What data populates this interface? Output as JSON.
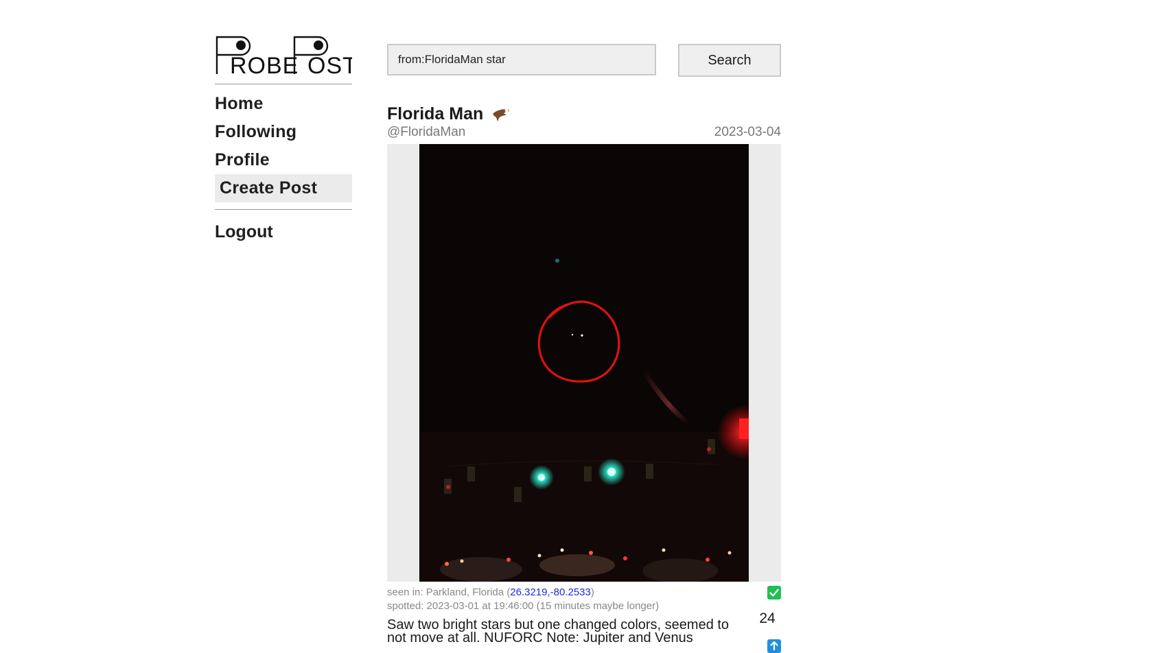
{
  "app": {
    "logo_text": "PROBEPOST"
  },
  "nav": {
    "items": [
      {
        "label": "Home",
        "active": false
      },
      {
        "label": "Following",
        "active": false
      },
      {
        "label": "Profile",
        "active": false
      },
      {
        "label": "Create Post",
        "active": true
      }
    ],
    "logout_label": "Logout"
  },
  "search": {
    "value": "from:FloridaMan star",
    "button_label": "Search"
  },
  "post": {
    "author_name": "Florida Man",
    "author_badge_icon": "eagle-icon",
    "author_handle": "@FloridaMan",
    "date": "2023-03-04",
    "image_icon": "night-sky-photo",
    "seen_in_prefix": "seen in: Parkland, Florida (",
    "seen_in_coords": "26.3219,-80.2533",
    "seen_in_suffix": ")",
    "spotted": "spotted: 2023-03-01 at 19:46:00 (15 minutes maybe longer)",
    "text": "Saw two bright stars but one changed colors, seemed to not move at all. NUFORC Note: Jupiter and Venus",
    "vote_count": "24",
    "verified_color": "#1fbf55",
    "upvote_color": "#1f8fe0"
  }
}
